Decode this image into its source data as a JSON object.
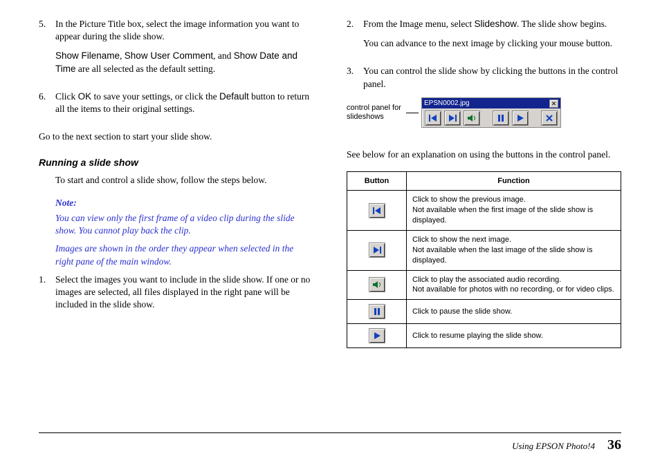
{
  "col1": {
    "item5_num": "5.",
    "item5_p1a": "In the Picture Title box, select the image information you want to appear during the slide show.",
    "item5_p2_a": "Show Filename",
    "item5_p2_b": ", ",
    "item5_p2_c": "Show User Comment",
    "item5_p2_d": ", and ",
    "item5_p2_e": "Show Date and Time",
    "item5_p2_f": " are all selected as the default setting.",
    "item6_num": "6.",
    "item6_a": "Click ",
    "item6_b": "OK",
    "item6_c": " to save your settings, or click the ",
    "item6_d": "Default",
    "item6_e": " button to return all the items to their original settings.",
    "goto": "Go to the next section to start your slide show.",
    "heading": "Running a slide show",
    "intro": "To start and control a slide show, follow the steps below.",
    "note_hd": "Note:",
    "note1": "You can view only the first frame of a video clip during the slide show. You cannot play back the clip.",
    "note2": "Images are shown in the order they appear when selected in the right pane of the main window.",
    "s1_num": "1.",
    "s1": "Select the images you want to include in the slide show. If one or no images are selected, all files displayed in the right pane will be included in the slide show."
  },
  "col2": {
    "s2_num": "2.",
    "s2_a": "From the Image menu, select ",
    "s2_b": "Slideshow",
    "s2_c": ". The slide show begins.",
    "s2_p2": "You can advance to the next image by clicking your mouse button.",
    "s3_num": "3.",
    "s3": "You can control the slide show by clicking the buttons in the control panel.",
    "panel_label": "control panel for slideshows",
    "panel_title": "EPSN0002.jpg",
    "see_below": "See below for an explanation on using the buttons in the control panel.",
    "th_button": "Button",
    "th_function": "Function",
    "row1": "Click to show the previous image.\nNot available when the first image of the slide show is displayed.",
    "row2": "Click to show the next image.\nNot available when the last image of the slide show is displayed.",
    "row3": "Click to play the associated audio recording.\nNot available for photos with no recording, or for video clips.",
    "row4": "Click to pause the slide show.",
    "row5": "Click to resume playing the slide show."
  },
  "footer": {
    "text": "Using EPSON Photo!4",
    "page": "36"
  }
}
